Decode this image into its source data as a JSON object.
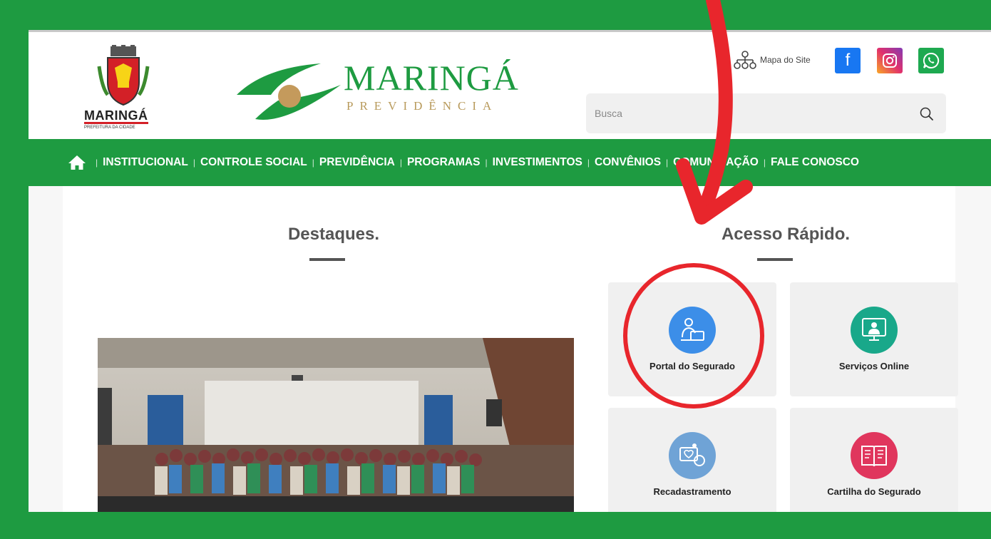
{
  "city": {
    "name": "MARINGÁ",
    "subtitle": "PREFEITURA DA CIDADE"
  },
  "brand": {
    "title": "MARINGÁ",
    "subtitle": "PREVIDÊNCIA",
    "primary_color": "#1e9b41",
    "accent_color": "#b89a5b"
  },
  "header": {
    "site_map_label": "Mapa do Site",
    "social": [
      {
        "icon": "facebook-icon",
        "label": "f"
      },
      {
        "icon": "instagram-icon"
      },
      {
        "icon": "whatsapp-icon"
      }
    ],
    "search": {
      "placeholder": "Busca"
    }
  },
  "nav": {
    "items": [
      "INSTITUCIONAL",
      "CONTROLE SOCIAL",
      "PREVIDÊNCIA",
      "PROGRAMAS",
      "INVESTIMENTOS",
      "CONVÊNIOS",
      "COMUNICAÇÃO",
      "FALE CONOSCO"
    ]
  },
  "main": {
    "highlights_title": "Destaques.",
    "quick_access_title": "Acesso Rápido.",
    "quick_access": [
      {
        "label": "Portal do Segurado",
        "icon": "user-laptop-icon",
        "color": "#3c8ee8"
      },
      {
        "label": "Serviços Online",
        "icon": "online-services-icon",
        "color": "#19a88a"
      },
      {
        "label": "Recadastramento",
        "icon": "registration-icon",
        "color": "#6fa3d6"
      },
      {
        "label": "Cartilha do Segurado",
        "icon": "booklet-icon",
        "color": "#e0365d"
      }
    ]
  },
  "annotation": {
    "color": "#e8262c"
  }
}
